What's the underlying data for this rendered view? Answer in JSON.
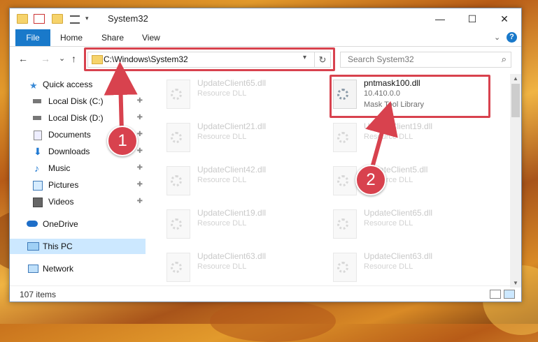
{
  "window": {
    "title": "System32",
    "minimize": "—",
    "maximize": "☐",
    "close": "✕"
  },
  "ribbon": {
    "tabs": [
      "File",
      "Home",
      "Share",
      "View"
    ],
    "help": "?",
    "expand": "⌄"
  },
  "navigation": {
    "back": "←",
    "forward": "→",
    "recent": "⌄",
    "up": "↑",
    "address": "C:\\Windows\\System32",
    "refresh": "↻",
    "search_placeholder": "Search System32"
  },
  "sidebar": {
    "items": [
      {
        "label": "Quick access",
        "icon": "star-icon",
        "pinned": false
      },
      {
        "label": "Local Disk (C:)",
        "icon": "drive-icon",
        "pinned": true
      },
      {
        "label": "Local Disk (D:)",
        "icon": "drive-icon",
        "pinned": true
      },
      {
        "label": "Documents",
        "icon": "documents-icon",
        "pinned": true
      },
      {
        "label": "Downloads",
        "icon": "download-icon",
        "pinned": true
      },
      {
        "label": "Music",
        "icon": "music-icon",
        "pinned": true
      },
      {
        "label": "Pictures",
        "icon": "pictures-icon",
        "pinned": true
      },
      {
        "label": "Videos",
        "icon": "videos-icon",
        "pinned": true
      },
      {
        "label": "OneDrive",
        "icon": "cloud-icon",
        "pinned": false
      },
      {
        "label": "This PC",
        "icon": "computer-icon",
        "pinned": false,
        "selected": true
      },
      {
        "label": "Network",
        "icon": "network-icon",
        "pinned": false
      }
    ]
  },
  "files": {
    "left_column": [
      {
        "name": "UpdateClient65.dll",
        "type": "Resource DLL"
      },
      {
        "name": "UpdateClient21.dll",
        "type": "Resource DLL"
      },
      {
        "name": "UpdateClient42.dll",
        "type": "Resource DLL"
      },
      {
        "name": "UpdateClient19.dll",
        "type": "Resource DLL"
      },
      {
        "name": "UpdateClient63.dll",
        "type": "Resource DLL"
      }
    ],
    "right_column": [
      {
        "name": "pntmask100.dll",
        "version": "10.410.0.0",
        "type": "Mask Tool Library",
        "active": true
      },
      {
        "name": "UpdateClient19.dll",
        "type": "Resource DLL"
      },
      {
        "name": "UpdateClient5.dll",
        "type": "Resource DLL"
      },
      {
        "name": "UpdateClient65.dll",
        "type": "Resource DLL"
      },
      {
        "name": "UpdateClient63.dll",
        "type": "Resource DLL"
      }
    ]
  },
  "status": {
    "item_count": "107 items"
  },
  "annotations": {
    "step1": "1",
    "step2": "2",
    "color": "#d8424e"
  },
  "pin_glyph": "📌"
}
